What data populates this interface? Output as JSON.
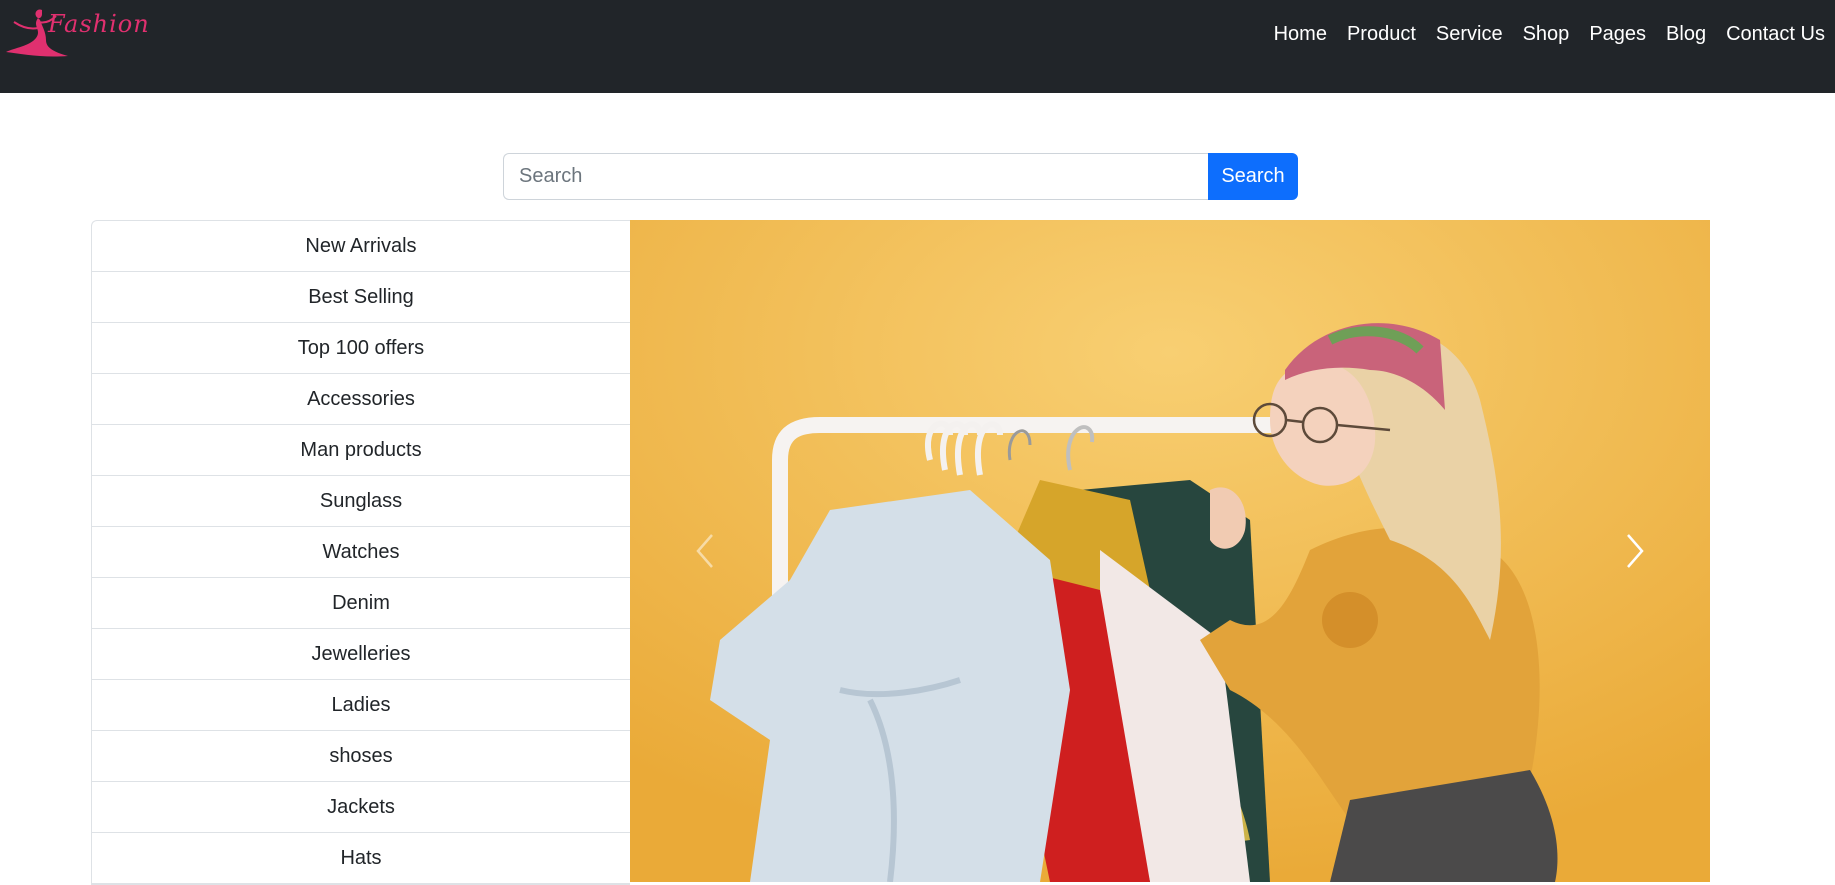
{
  "brand": {
    "logo_text": "Fashion"
  },
  "nav": {
    "items": [
      "Home",
      "Product",
      "Service",
      "Shop",
      "Pages",
      "Blog",
      "Contact Us"
    ]
  },
  "search": {
    "placeholder": "Search",
    "value": "",
    "button_label": "Search"
  },
  "categories": [
    "New Arrivals",
    "Best Selling",
    "Top 100 offers",
    "Accessories",
    "Man products",
    "Sunglass",
    "Watches",
    "Denim",
    "Jewelleries",
    "Ladies",
    "shoses",
    "Jackets",
    "Hats"
  ],
  "carousel": {
    "prev_icon": "chevron-left-icon",
    "next_icon": "chevron-right-icon",
    "background_color": "#f2b84a"
  },
  "colors": {
    "navbar": "#212529",
    "brand": "#e0306f",
    "primary": "#0d6efd"
  }
}
